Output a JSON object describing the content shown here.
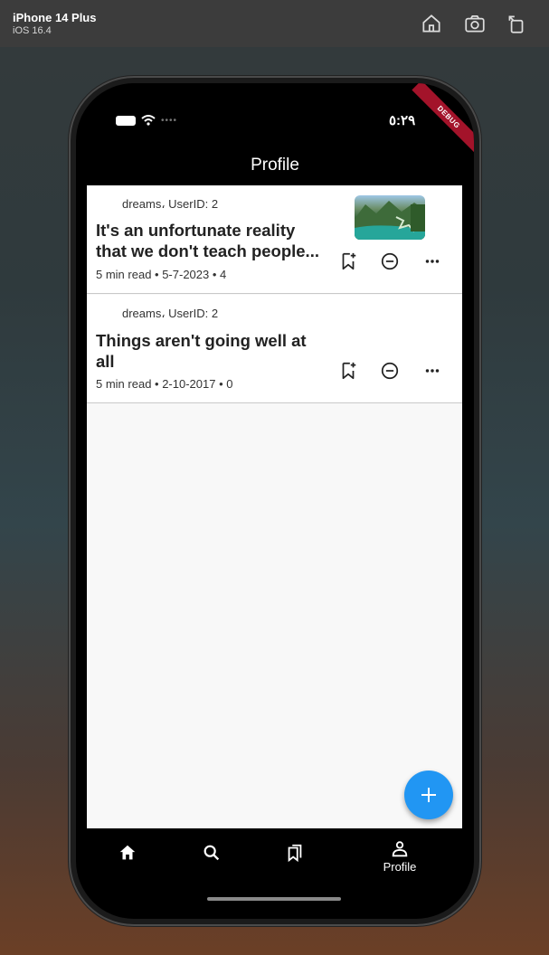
{
  "simulator": {
    "device": "iPhone 14 Plus",
    "os": "iOS 16.4"
  },
  "status_bar": {
    "time": "٥:٢٩",
    "debug_banner": "DEBUG"
  },
  "app_bar": {
    "title": "Profile"
  },
  "posts": [
    {
      "meta_top": "dreams، UserID: 2",
      "title": "It's an unfortunate reality that we don't teach people...",
      "meta_bottom": "5 min read • 5-7-2023 • 4",
      "has_image": true
    },
    {
      "meta_top": "dreams، UserID: 2",
      "title": "Things aren't going well at all",
      "meta_bottom": "5 min read • 2-10-2017 • 0",
      "has_image": false
    }
  ],
  "fab": {
    "icon": "plus-icon"
  },
  "bottom_nav": {
    "items": [
      {
        "icon": "home-icon",
        "label": ""
      },
      {
        "icon": "search-icon",
        "label": ""
      },
      {
        "icon": "bookmarks-icon",
        "label": ""
      },
      {
        "icon": "person-icon",
        "label": "Profile"
      }
    ],
    "selected_index": 3
  },
  "colors": {
    "accent": "#2196f3",
    "debug": "#a3132a"
  }
}
